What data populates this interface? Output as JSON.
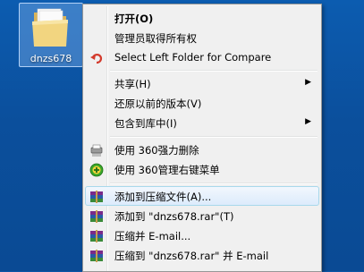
{
  "desktop": {
    "folder_label": "dnzs678"
  },
  "menu": {
    "items": {
      "open": {
        "label": "打开(O)"
      },
      "take_ownership": {
        "label": "管理员取得所有权"
      },
      "select_left": {
        "label": "Select Left Folder for Compare"
      },
      "share": {
        "label": "共享(H)"
      },
      "restore": {
        "label": "还原以前的版本(V)"
      },
      "include_library": {
        "label": "包含到库中(I)"
      },
      "delete_360": {
        "label": "使用 360强力删除"
      },
      "manage_360": {
        "label": "使用 360管理右键菜单"
      },
      "add_archive": {
        "label": "添加到压缩文件(A)..."
      },
      "add_rar": {
        "label": "添加到 \"dnzs678.rar\"(T)"
      },
      "compress_email": {
        "label": "压缩并 E-mail..."
      },
      "compress_rar_email": {
        "label": "压缩到 \"dnzs678.rar\" 并 E-mail"
      }
    },
    "submenu_arrow": "▶",
    "icons": {
      "select_left": "undo-arrow-icon",
      "delete_360": "shredder-icon",
      "manage_360": "green-plus-icon",
      "winrar": "winrar-books-icon"
    },
    "colors": {
      "hover_bg": "#dcebfc",
      "hover_border": "#a8d8eb"
    }
  }
}
